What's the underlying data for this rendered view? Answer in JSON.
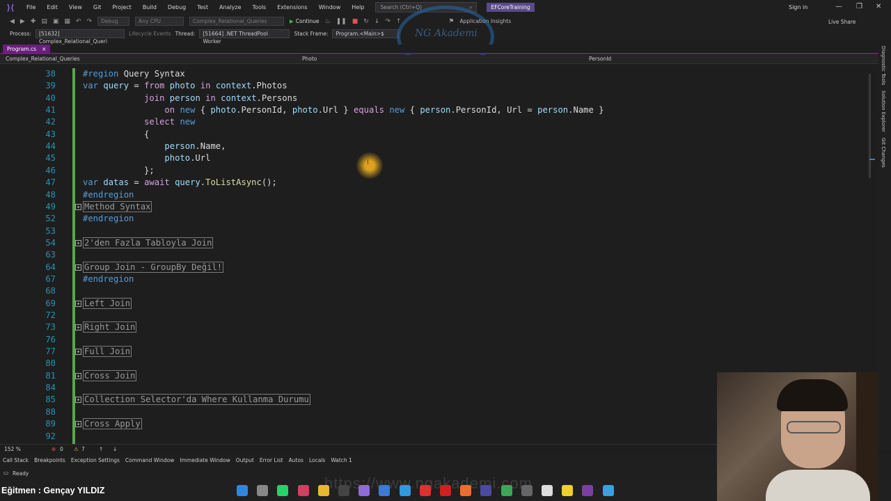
{
  "menu": {
    "items": [
      "File",
      "Edit",
      "View",
      "Git",
      "Project",
      "Build",
      "Debug",
      "Test",
      "Analyze",
      "Tools",
      "Extensions",
      "Window",
      "Help"
    ],
    "search_placeholder": "Search (Ctrl+Q)",
    "solution_name": "EFCoreTraining",
    "sign_in": "Sign in"
  },
  "toolbar": {
    "config": "Debug",
    "platform": "Any CPU",
    "startup_project": "Complex_Relational_Queries",
    "continue_label": "Continue",
    "app_insights": "Application Insights",
    "live_share": "Live Share"
  },
  "debug_location": {
    "process_label": "Process:",
    "process_value": "[51632] Complex_Relational_Queri",
    "lifecycle_label": "Lifecycle Events",
    "thread_label": "Thread:",
    "thread_value": "[51664] .NET ThreadPool Worker",
    "stack_label": "Stack Frame:",
    "stack_value": "Program.<Main>$"
  },
  "logo": {
    "text": "NG Akademi"
  },
  "tab": {
    "title": "Program.cs",
    "close": "×"
  },
  "navbar": {
    "project": "Complex_Relational_Queries",
    "type": "Photo",
    "member": "PersonId"
  },
  "code_lines": [
    {
      "ln": "38",
      "fold": "",
      "html": "<span class=\"kw\">#region</span> Query Syntax"
    },
    {
      "ln": "39",
      "fold": "",
      "html": "<span class=\"kw\">var</span> <span class=\"vr\">query</span> = <span class=\"kw2\">from</span> <span class=\"vr\">photo</span> <span class=\"kw2\">in</span> <span class=\"vr\">context</span>.Photos"
    },
    {
      "ln": "40",
      "fold": "",
      "html": "            <span class=\"kw2\">join</span> <span class=\"vr\">person</span> <span class=\"kw2\">in</span> <span class=\"vr\">context</span>.Persons"
    },
    {
      "ln": "41",
      "fold": "",
      "html": "                <span class=\"kw2\">on</span> <span class=\"kw\">new</span> { <span class=\"vr\">photo</span>.PersonId, <span class=\"vr\">photo</span>.Url } <span class=\"kw2\">equals</span> <span class=\"kw\">new</span> { <span class=\"vr\">person</span>.PersonId, Url = <span class=\"vr\">person</span>.Name }"
    },
    {
      "ln": "42",
      "fold": "",
      "html": "            <span class=\"kw2\">select</span> <span class=\"kw\">new</span>"
    },
    {
      "ln": "43",
      "fold": "",
      "html": "            {"
    },
    {
      "ln": "44",
      "fold": "",
      "html": "                <span class=\"vr\">person</span>.Name,"
    },
    {
      "ln": "45",
      "fold": "",
      "html": "                <span class=\"vr\">photo</span>.Url"
    },
    {
      "ln": "46",
      "fold": "",
      "html": "            };"
    },
    {
      "ln": "47",
      "fold": "",
      "html": "<span class=\"kw\">var</span> <span class=\"vr\">datas</span> = <span class=\"kw2\">await</span> <span class=\"vr\">query</span>.<span class=\"mt\">ToListAsync</span>();"
    },
    {
      "ln": "48",
      "fold": "",
      "html": "<span class=\"kw\">#endregion</span>"
    },
    {
      "ln": "49",
      "fold": "+",
      "html": "<span class=\"collapsed\">Method Syntax</span>"
    },
    {
      "ln": "52",
      "fold": "",
      "html": "<span class=\"kw\">#endregion</span>"
    },
    {
      "ln": "53",
      "fold": "",
      "html": ""
    },
    {
      "ln": "54",
      "fold": "+",
      "html": "<span class=\"collapsed\">2'den Fazla Tabloyla Join</span>"
    },
    {
      "ln": "63",
      "fold": "",
      "html": ""
    },
    {
      "ln": "64",
      "fold": "+",
      "html": "<span class=\"collapsed\">Group Join - GroupBy Değil!</span>"
    },
    {
      "ln": "67",
      "fold": "",
      "html": "<span class=\"kw\">#endregion</span>"
    },
    {
      "ln": "68",
      "fold": "",
      "html": ""
    },
    {
      "ln": "69",
      "fold": "+",
      "html": "<span class=\"collapsed\">Left Join</span>"
    },
    {
      "ln": "72",
      "fold": "",
      "html": ""
    },
    {
      "ln": "73",
      "fold": "+",
      "html": "<span class=\"collapsed\">Right Join</span>"
    },
    {
      "ln": "76",
      "fold": "",
      "html": ""
    },
    {
      "ln": "77",
      "fold": "+",
      "html": "<span class=\"collapsed\">Full Join</span>"
    },
    {
      "ln": "80",
      "fold": "",
      "html": ""
    },
    {
      "ln": "81",
      "fold": "+",
      "html": "<span class=\"collapsed\">Cross Join</span>"
    },
    {
      "ln": "84",
      "fold": "",
      "html": ""
    },
    {
      "ln": "85",
      "fold": "+",
      "html": "<span class=\"collapsed\">Collection Selector'da Where Kullanma Durumu</span>"
    },
    {
      "ln": "88",
      "fold": "",
      "html": ""
    },
    {
      "ln": "89",
      "fold": "+",
      "html": "<span class=\"collapsed\">Cross Apply</span>"
    },
    {
      "ln": "92",
      "fold": "",
      "html": ""
    }
  ],
  "editor_status": {
    "zoom": "152 %",
    "errors": "0",
    "warnings": "7"
  },
  "tool_windows": [
    "Call Stack",
    "Breakpoints",
    "Exception Settings",
    "Command Window",
    "Immediate Window",
    "Output",
    "Error List",
    "Autos",
    "Locals",
    "Watch 1"
  ],
  "side_panels": [
    "Diagnostic Tools",
    "Solution Explorer",
    "Git Changes"
  ],
  "status": {
    "ready": "Ready"
  },
  "overlay": {
    "trainer": "Eğitmen : Gençay YILDIZ",
    "watermark": "https://www.ngakademi.com"
  },
  "taskbar_apps": [
    {
      "name": "windows-start-icon",
      "color": "#2f86e0"
    },
    {
      "name": "task-view-icon",
      "color": "#888888"
    },
    {
      "name": "whatsapp-icon",
      "color": "#25d366"
    },
    {
      "name": "snipping-tool-icon",
      "color": "#d04060"
    },
    {
      "name": "file-explorer-icon",
      "color": "#e8b830"
    },
    {
      "name": "terminal-icon",
      "color": "#444444"
    },
    {
      "name": "visual-studio-icon",
      "color": "#8f6ad8"
    },
    {
      "name": "photos-icon",
      "color": "#3a7bd5"
    },
    {
      "name": "edge-icon",
      "color": "#2f9ae0"
    },
    {
      "name": "opera-icon",
      "color": "#e03030"
    },
    {
      "name": "record-icon",
      "color": "#d02020"
    },
    {
      "name": "postman-icon",
      "color": "#ef6c2f"
    },
    {
      "name": "eclipse-icon",
      "color": "#4a4aa0"
    },
    {
      "name": "chrome-icon",
      "color": "#3aa757"
    },
    {
      "name": "app-icon",
      "color": "#666666"
    },
    {
      "name": "openai-icon",
      "color": "#dddddd"
    },
    {
      "name": "sticky-notes-icon",
      "color": "#f0d030"
    },
    {
      "name": "onenote-icon",
      "color": "#7b3fa0"
    },
    {
      "name": "notepad-icon",
      "color": "#3aa0e0"
    }
  ]
}
